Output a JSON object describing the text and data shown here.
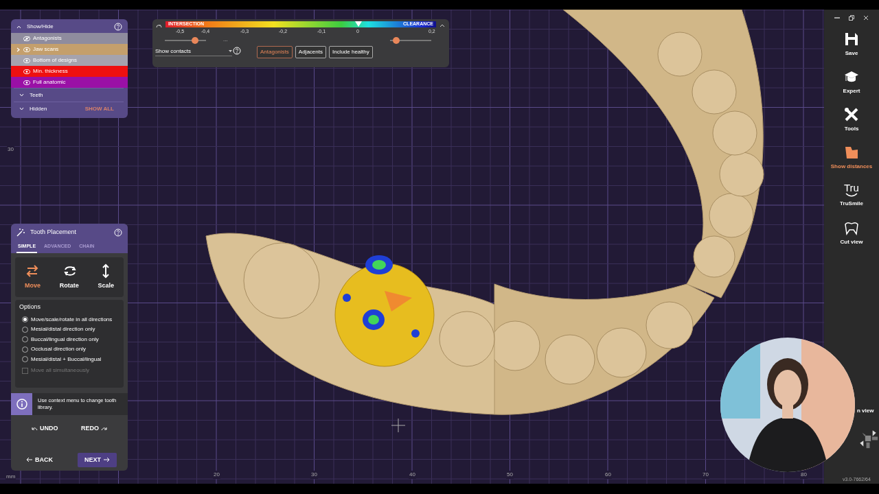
{
  "show_hide": {
    "title": "Show/Hide",
    "expanded": true,
    "items": [
      {
        "label": "Antagonists",
        "visible": false,
        "selected": false,
        "color": "#8f8c9e"
      },
      {
        "label": "Jaw scans",
        "visible": true,
        "selected": true,
        "color": "#c49f6c"
      },
      {
        "label": "Bottom of designs",
        "visible": true,
        "selected": false,
        "color": "#a5a3ae"
      },
      {
        "label": "Min. thickness",
        "visible": true,
        "selected": false,
        "color": "#ee1010"
      },
      {
        "label": "Full anatomic",
        "visible": true,
        "selected": false,
        "color": "#9a10a6"
      }
    ],
    "sections": [
      {
        "label": "Teeth",
        "expanded": false
      },
      {
        "label": "Hidden",
        "expanded": false,
        "action": "SHOW ALL"
      }
    ]
  },
  "distance_panel": {
    "left_label": "INTERSECTION",
    "right_label": "CLEARANCE",
    "ticks": [
      "-0,5",
      "-0,4",
      "-0,3",
      "-0,2",
      "-0,1",
      "0",
      "0,2"
    ],
    "sliders": [
      {
        "level": 0.73
      },
      {
        "level": 0.15
      }
    ],
    "more": "...",
    "dropdown": "Show contacts",
    "filters": [
      {
        "label": "Antagonists",
        "selected": true
      },
      {
        "label": "Adjacents",
        "selected": false
      },
      {
        "label": "Include healthy",
        "selected": false
      }
    ]
  },
  "tools": [
    {
      "label": "Save",
      "kind": "save",
      "selected": false
    },
    {
      "label": "Expert",
      "kind": "expert",
      "selected": false
    },
    {
      "label": "Tools",
      "kind": "tools",
      "selected": false
    },
    {
      "label": "Show distances",
      "kind": "distances",
      "selected": true
    },
    {
      "label": "TruSmile",
      "kind": "trusmile",
      "selected": false,
      "logo_text": "Tru"
    },
    {
      "label": "Cut view",
      "kind": "cut",
      "selected": false
    }
  ],
  "partial_tool": "n view",
  "tooth_placement": {
    "title": "Tooth Placement",
    "tabs": [
      {
        "label": "SIMPLE",
        "selected": true
      },
      {
        "label": "ADVANCED",
        "selected": false
      },
      {
        "label": "CHAIN",
        "selected": false
      }
    ],
    "modes": [
      {
        "label": "Move",
        "kind": "move",
        "selected": true
      },
      {
        "label": "Rotate",
        "kind": "rotate",
        "selected": false
      },
      {
        "label": "Scale",
        "kind": "scale",
        "selected": false
      }
    ],
    "options_title": "Options",
    "options": [
      {
        "label": "Move/scale/rotate in all directions",
        "selected": true
      },
      {
        "label": "Mesial/distal direction only",
        "selected": false
      },
      {
        "label": "Buccal/lingual direction only",
        "selected": false
      },
      {
        "label": "Occlusal direction only",
        "selected": false
      },
      {
        "label": "Mesial/distal + Buccal/lingual",
        "selected": false
      }
    ],
    "checkbox": {
      "label": "Move all simultaneously",
      "checked": false,
      "disabled": true
    },
    "info": "Use context menu to change tooth library.",
    "undo": "UNDO",
    "redo": "REDO",
    "back": "BACK",
    "next": "NEXT"
  },
  "axis": {
    "x_labels": [
      "20",
      "30",
      "40",
      "50",
      "60",
      "70",
      "80"
    ],
    "y_label": "30",
    "unit": "mm"
  },
  "version": "v3.0-7662/64"
}
